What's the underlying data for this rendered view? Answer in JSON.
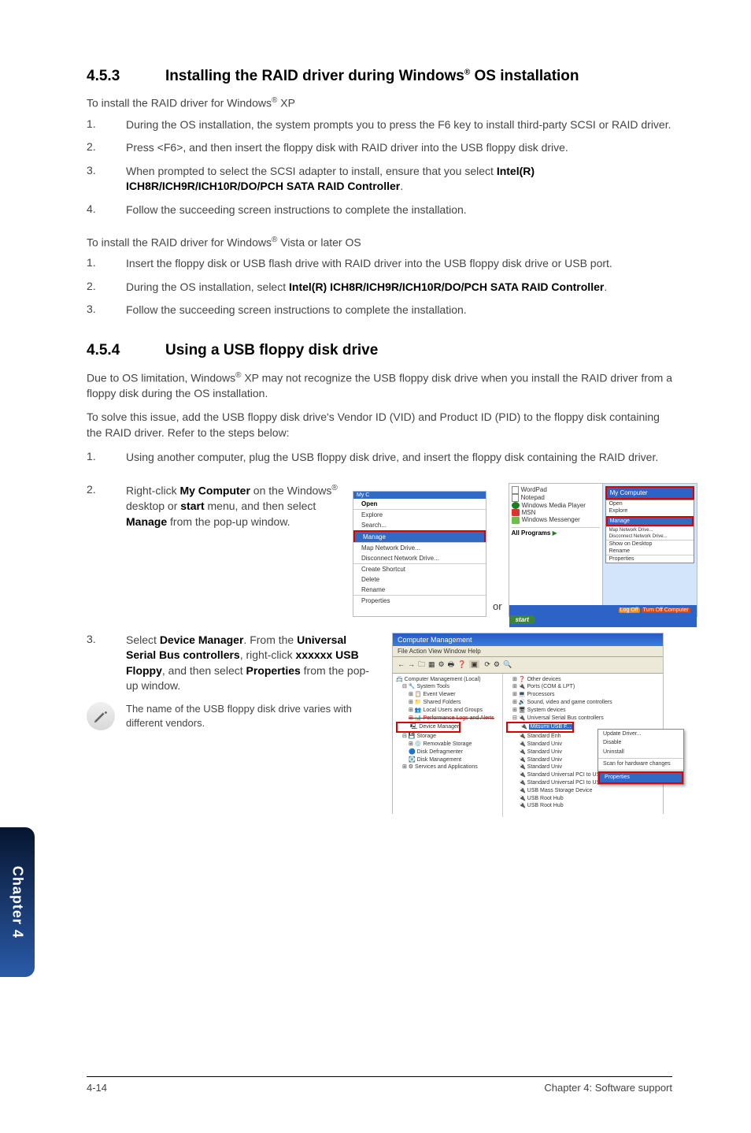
{
  "section453": {
    "number": "4.5.3",
    "title_a": "Installing the RAID driver during Windows",
    "title_b": " OS installation",
    "intro_xp_a": "To install the RAID driver for Windows",
    "intro_xp_b": " XP",
    "xp_steps": [
      "During the OS installation, the system prompts you to press the F6 key to install third-party SCSI or RAID driver.",
      "Press <F6>, and then insert the floppy disk with RAID driver into the USB floppy disk drive.",
      "When prompted to select the SCSI adapter to install, ensure that you select |Intel(R) ICH8R/ICH9R/ICH10R/DO/PCH SATA RAID Controller|.",
      "Follow the succeeding screen instructions to complete the installation."
    ],
    "intro_vista_a": "To install the RAID driver for Windows",
    "intro_vista_b": " Vista or later OS",
    "vista_steps": [
      "Insert the floppy disk or USB flash drive with RAID driver into the USB floppy disk drive or USB port.",
      "During the OS installation, select |Intel(R) ICH8R/ICH9R/ICH10R/DO/PCH SATA RAID Controller|.",
      "Follow the succeeding screen instructions to complete the installation."
    ]
  },
  "section454": {
    "number": "4.5.4",
    "title": "Using a USB floppy disk drive",
    "p1_a": "Due to OS limitation, Windows",
    "p1_b": " XP may not recognize the USB floppy disk drive when you install the RAID driver from a floppy disk during the OS installation.",
    "p2": "To solve this issue, add the USB floppy disk drive's Vendor ID (VID) and Product ID (PID) to the floppy disk containing the RAID driver. Refer to the steps below:",
    "step1": "Using another computer, plug the USB floppy disk drive, and insert the floppy disk containing the RAID driver.",
    "step2_a": "Right-click ",
    "step2_b": "My Computer",
    "step2_c": " on the Windows",
    "step2_d": " desktop or ",
    "step2_e": "start",
    "step2_f": " menu, and then select ",
    "step2_g": "Manage",
    "step2_h": " from the pop-up window.",
    "step3_a": "Select ",
    "step3_b": "Device Manager",
    "step3_c": ". From the ",
    "step3_d": "Universal Serial Bus controllers",
    "step3_e": ", right-click ",
    "step3_f": "xxxxxx USB Floppy",
    "step3_g": ", and then select ",
    "step3_h": "Properties",
    "step3_i": " from the pop-up window.",
    "note": "The name of the USB floppy disk drive varies with different vendors.",
    "or": "or"
  },
  "myc_menu": {
    "open": "Open",
    "explore": "Explore",
    "search": "Search...",
    "manage": "Manage",
    "map": "Map Network Drive...",
    "disc": "Disconnect Network Drive...",
    "shortcut": "Create Shortcut",
    "delete": "Delete",
    "rename": "Rename",
    "properties": "Properties"
  },
  "start_menu": {
    "header": "My Computer",
    "wordpad": "WordPad",
    "notepad": "Notepad",
    "wmp": "Windows Media Player",
    "msn": "MSN",
    "msgr": "Windows Messenger",
    "allp": "All Programs",
    "open": "Open",
    "explore": "Explore",
    "manage": "Manage",
    "disc": "Disconnect Network Drive...",
    "desk": "Show on Desktop",
    "rename": "Rename",
    "prop": "Properties",
    "logoff": "Log Off",
    "turnoff": "Turn Off Computer",
    "startbtn": "start"
  },
  "cm": {
    "title": "Computer Management",
    "menu": "File   Action   View   Window   Help",
    "tree": {
      "root": "Computer Management (Local)",
      "st": "System Tools",
      "ev": "Event Viewer",
      "sf": "Shared Folders",
      "lu": "Local Users and Groups",
      "pla": "Performance Logs and Alerts",
      "dm": "Device Manager",
      "storage": "Storage",
      "rs": "Removable Storage",
      "dd": "Disk Defragmenter",
      "dmg": "Disk Management",
      "sa": "Services and Applications"
    },
    "right": {
      "other": "Other devices",
      "ports": "Ports (COM & LPT)",
      "proc": "Processors",
      "sound": "Sound, video and game controllers",
      "sysdev": "System devices",
      "usbc": "Universal Serial Bus controllers",
      "floppy": "Mitsumi USB F...",
      "s1": "Standard Enh",
      "s2": "Standard Univ",
      "s3": "Standard Univ",
      "s4": "Standard Univ",
      "s5": "Standard Univ",
      "s6": "Standard Universal PCI to USB Host Controller",
      "s7": "Standard Universal PCI to USB Host Controller",
      "mass": "USB Mass Storage Device",
      "rh1": "USB Root Hub",
      "rh2": "USB Root Hub"
    },
    "ctx": {
      "upd": "Update Driver...",
      "dis": "Disable",
      "uni": "Uninstall",
      "scan": "Scan for hardware changes",
      "prop": "Properties"
    }
  },
  "sidetab": "Chapter 4",
  "footer": {
    "left": "4-14",
    "right": "Chapter 4: Software support"
  }
}
